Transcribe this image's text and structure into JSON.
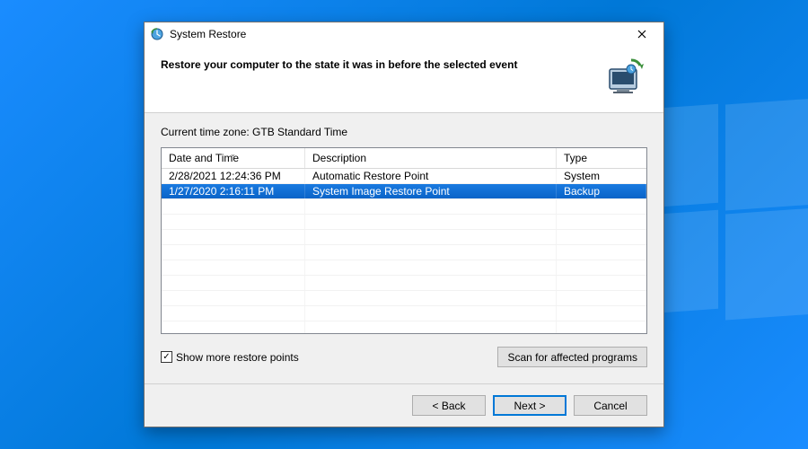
{
  "window": {
    "title": "System Restore"
  },
  "header": {
    "headline": "Restore your computer to the state it was in before the selected event"
  },
  "timezone_label": "Current time zone: GTB Standard Time",
  "columns": {
    "date": "Date and Time",
    "desc": "Description",
    "type": "Type"
  },
  "rows": [
    {
      "date": "2/28/2021 12:24:36 PM",
      "desc": "Automatic Restore Point",
      "type": "System",
      "selected": false
    },
    {
      "date": "1/27/2020 2:16:11 PM",
      "desc": "System Image Restore Point",
      "type": "Backup",
      "selected": true
    }
  ],
  "checkbox": {
    "label": "Show more restore points",
    "checked": true
  },
  "buttons": {
    "scan": "Scan for affected programs",
    "back": "< Back",
    "next": "Next >",
    "cancel": "Cancel"
  }
}
